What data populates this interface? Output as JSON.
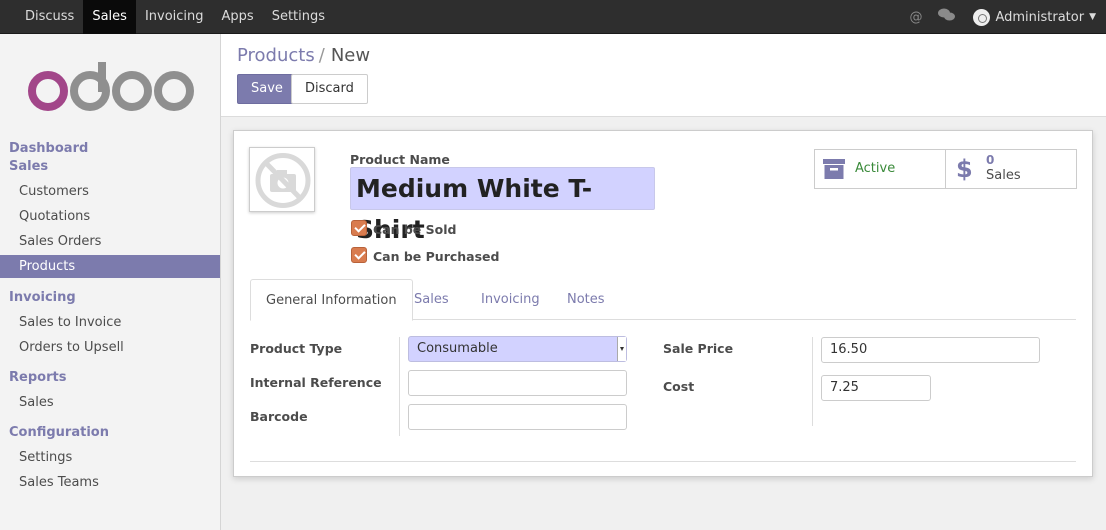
{
  "topbar": {
    "menu": [
      "Discuss",
      "Sales",
      "Invoicing",
      "Apps",
      "Settings"
    ],
    "active": "Sales",
    "user": "Administrator"
  },
  "sidebar": {
    "logo_text": "odoo",
    "sections": [
      {
        "title": "Dashboard",
        "items": []
      },
      {
        "title": "Sales",
        "items": [
          "Customers",
          "Quotations",
          "Sales Orders",
          "Products"
        ]
      },
      {
        "title": "Invoicing",
        "items": [
          "Sales to Invoice",
          "Orders to Upsell"
        ]
      },
      {
        "title": "Reports",
        "items": [
          "Sales"
        ]
      },
      {
        "title": "Configuration",
        "items": [
          "Settings",
          "Sales Teams"
        ]
      }
    ],
    "active_item": "Products"
  },
  "breadcrumb": {
    "parent": "Products",
    "separator": "/",
    "current": "New"
  },
  "buttons": {
    "save": "Save",
    "discard": "Discard"
  },
  "form": {
    "product_name_label": "Product Name",
    "product_name": "Medium White T-Shirt",
    "can_be_sold_label": "Can be Sold",
    "can_be_sold": true,
    "can_be_purchased_label": "Can be Purchased",
    "can_be_purchased": true,
    "stat_active": "Active",
    "stat_sales_count": "0",
    "stat_sales_label": "Sales",
    "tabs": [
      "General Information",
      "Sales",
      "Invoicing",
      "Notes"
    ],
    "active_tab": "General Information",
    "fields": {
      "product_type_label": "Product Type",
      "product_type": "Consumable",
      "internal_reference_label": "Internal Reference",
      "internal_reference": "",
      "barcode_label": "Barcode",
      "barcode": "",
      "sale_price_label": "Sale Price",
      "sale_price": "16.50",
      "cost_label": "Cost",
      "cost": "7.25"
    }
  },
  "colors": {
    "brand": "#7c7bad",
    "highlight_input": "#d2d2ff",
    "checkbox": "#d97c4f",
    "active_green": "#3a8a3a"
  }
}
